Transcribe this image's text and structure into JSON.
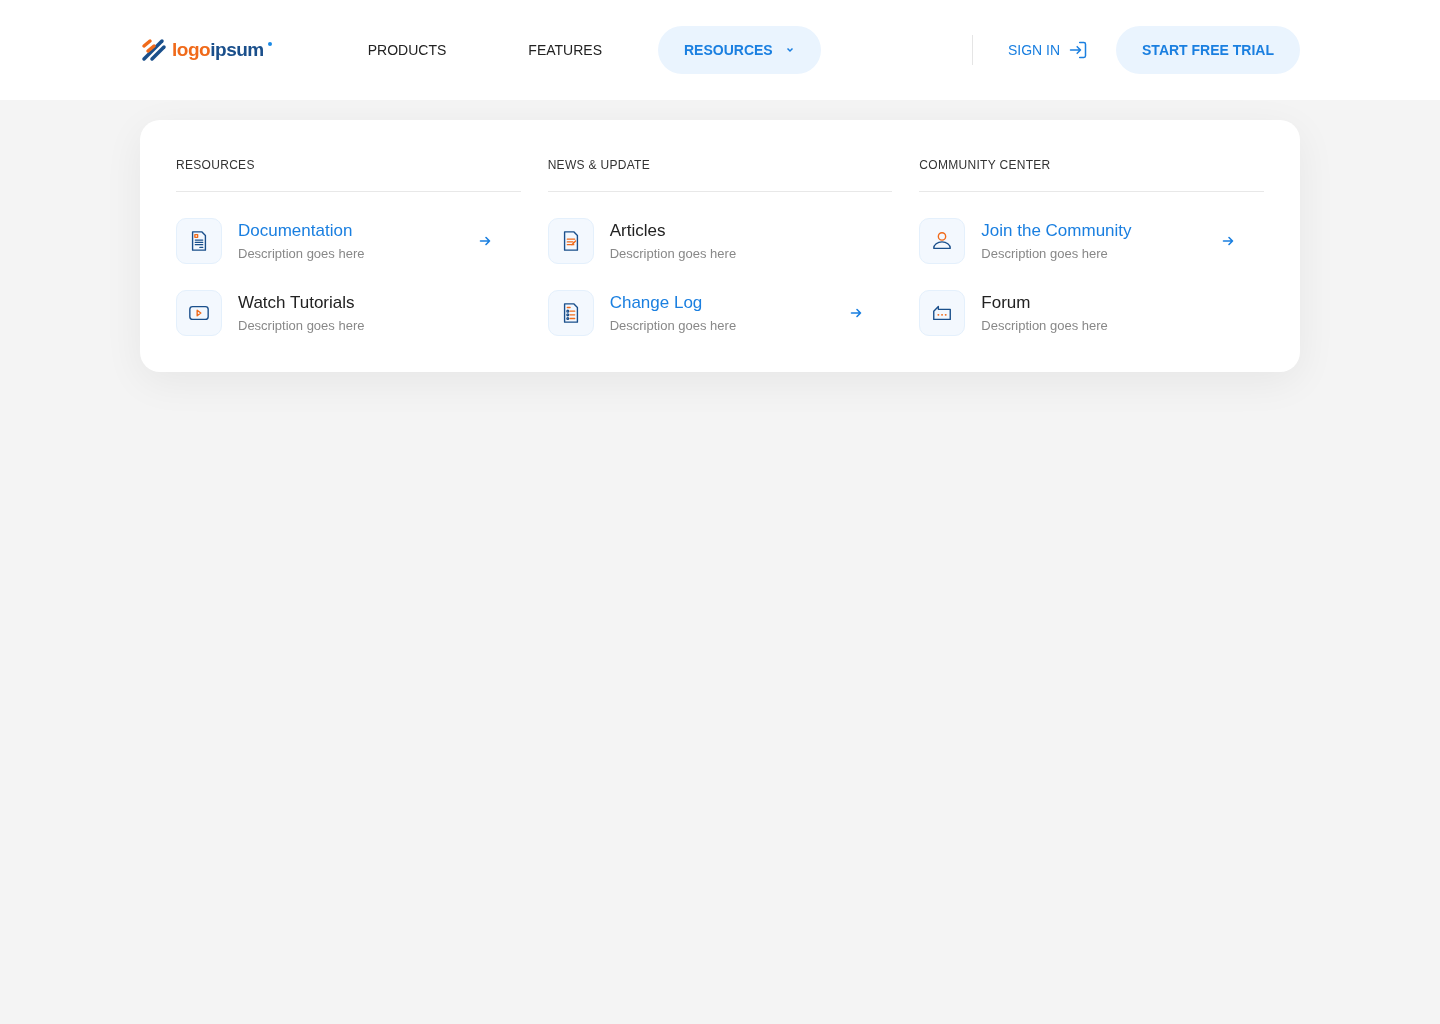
{
  "logo": {
    "first": "logo",
    "second": "ipsum"
  },
  "nav": [
    {
      "label": "PRODUCTS",
      "selected": false,
      "dropdown": false
    },
    {
      "label": "FEATURES",
      "selected": false,
      "dropdown": false
    },
    {
      "label": "RESOURCES",
      "selected": true,
      "dropdown": true
    }
  ],
  "sign_in": "SIGN IN",
  "cta": "START FREE TRIAL",
  "menu": {
    "columns": [
      {
        "heading": "RESOURCES",
        "items": [
          {
            "kind": "document",
            "title": "Documentation",
            "description": "Description goes here",
            "highlighted": true
          },
          {
            "kind": "video",
            "title": "Watch Tutorials",
            "description": "Description goes here",
            "highlighted": false
          }
        ]
      },
      {
        "heading": "NEWS & UPDATE",
        "items": [
          {
            "kind": "article",
            "title": "Articles",
            "description": "Description goes here",
            "highlighted": false
          },
          {
            "kind": "list",
            "title": "Change Log",
            "description": "Description goes here",
            "highlighted": true
          }
        ]
      },
      {
        "heading": "COMMUNITY CENTER",
        "items": [
          {
            "kind": "person",
            "title": "Join the Community",
            "description": "Description goes here",
            "highlighted": true
          },
          {
            "kind": "chat",
            "title": "Forum",
            "description": "Description goes here",
            "highlighted": false
          }
        ]
      }
    ]
  }
}
